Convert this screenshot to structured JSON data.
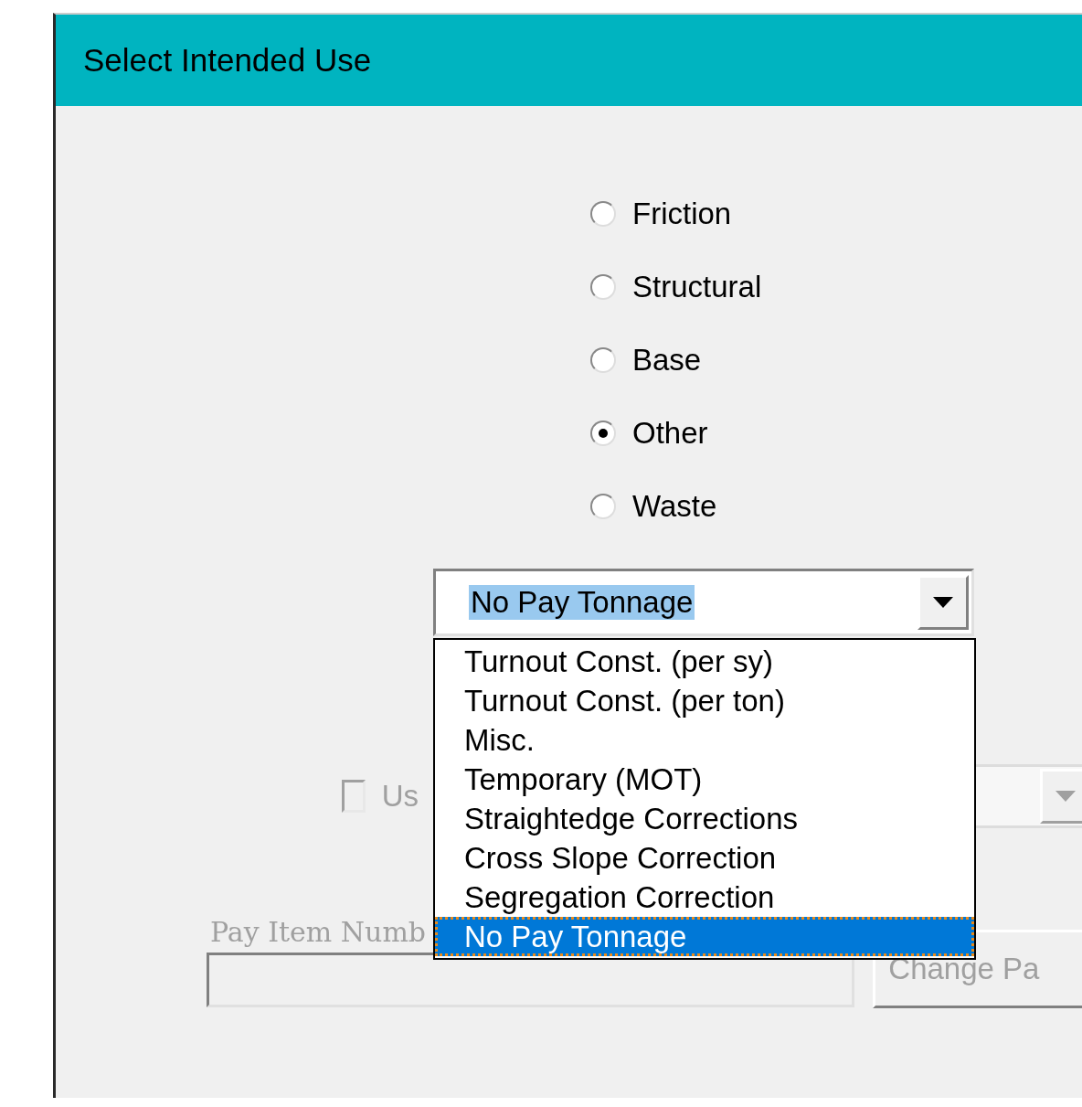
{
  "window": {
    "title": "Select Intended Use"
  },
  "radios": [
    {
      "label": "Friction",
      "selected": false
    },
    {
      "label": "Structural",
      "selected": false
    },
    {
      "label": "Base",
      "selected": false
    },
    {
      "label": "Other",
      "selected": true
    },
    {
      "label": "Waste",
      "selected": false
    }
  ],
  "combo": {
    "value": "No Pay Tonnage",
    "expanded": true
  },
  "list": [
    {
      "label": "Turnout Const. (per sy)",
      "selected": false
    },
    {
      "label": "Turnout Const. (per ton)",
      "selected": false
    },
    {
      "label": "Misc.",
      "selected": false
    },
    {
      "label": "Temporary (MOT)",
      "selected": false
    },
    {
      "label": "Straightedge Corrections",
      "selected": false
    },
    {
      "label": "Cross Slope Correction",
      "selected": false
    },
    {
      "label": "Segregation Correction",
      "selected": false
    },
    {
      "label": "No Pay Tonnage",
      "selected": true
    }
  ],
  "checkbox": {
    "label": "Us",
    "checked": false,
    "disabled": true
  },
  "second_combo": {
    "disabled": true
  },
  "pay_item": {
    "label": "Pay Item Numb",
    "disabled": true
  },
  "change_button": {
    "label": "Change Pa",
    "disabled": true
  }
}
